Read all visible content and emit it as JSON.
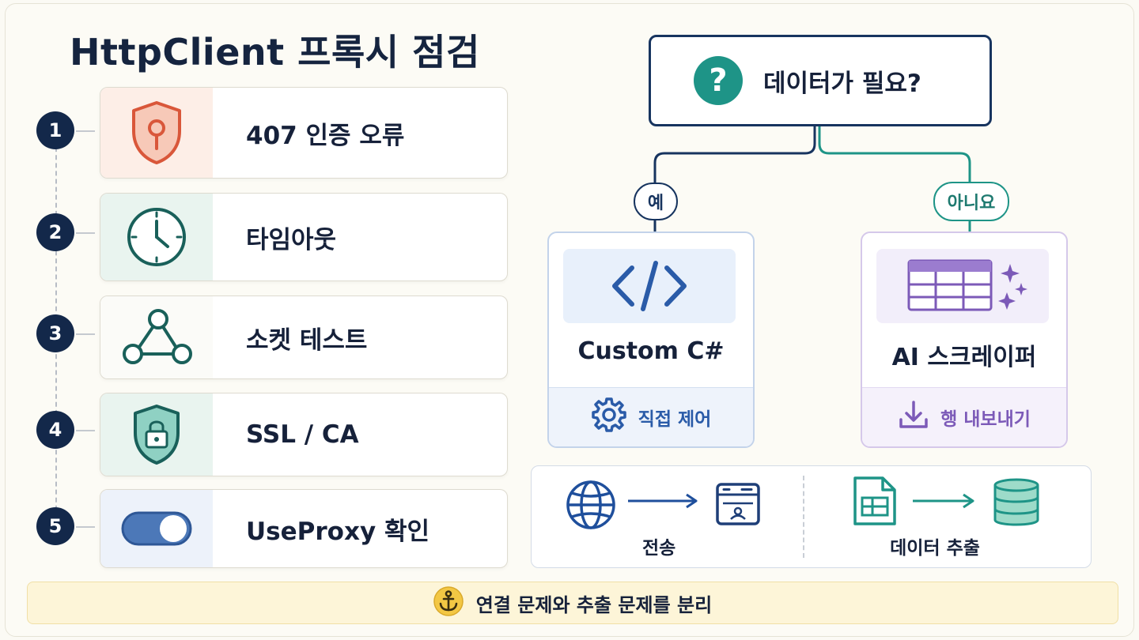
{
  "title": "HttpClient 프록시 점검",
  "checklist": [
    {
      "num": "1",
      "label": "407 인증 오류",
      "icon": "shield-keyhole-icon"
    },
    {
      "num": "2",
      "label": "타임아웃",
      "icon": "clock-icon"
    },
    {
      "num": "3",
      "label": "소켓 테스트",
      "icon": "network-nodes-icon"
    },
    {
      "num": "4",
      "label": "SSL / CA",
      "icon": "shield-lock-icon"
    },
    {
      "num": "5",
      "label": "UseProxy 확인",
      "icon": "toggle-switch-icon"
    }
  ],
  "decision": {
    "question": "데이터가 필요?",
    "yes_label": "예",
    "no_label": "아니요",
    "options": [
      {
        "name": "Custom C#",
        "footer": "직접 제어",
        "icon": "code-brackets-icon",
        "footer_icon": "gear-icon"
      },
      {
        "name": "AI 스크레이퍼",
        "footer": "행 내보내기",
        "icon": "table-sparkle-icon",
        "footer_icon": "download-icon"
      }
    ]
  },
  "flow": {
    "left_caption": "전송",
    "right_caption": "데이터 추출"
  },
  "banner": {
    "text": "연결 문제와 추출 문제를 분리",
    "icon": "anchor-icon"
  },
  "colors": {
    "navy": "#13284a",
    "teal": "#1e9487",
    "blue": "#2a5ba8",
    "purple": "#7c5ab8",
    "red": "#d9573a",
    "banner_bg": "#fdf5d8"
  }
}
